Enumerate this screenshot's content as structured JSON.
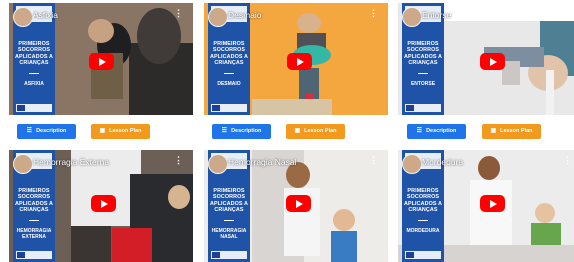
{
  "panel": {
    "title": "PRIMEIROS SOCORROS APLICADOS A CRIANÇAS"
  },
  "videos": [
    {
      "title": "Asfixia",
      "topic": "ASFIXIA",
      "bg": "#8a7a6a"
    },
    {
      "title": "Desmaio",
      "topic": "DESMAIO",
      "bg": "#f5a23f"
    },
    {
      "title": "Entorse",
      "topic": "ENTORSE",
      "bg": "#dedede"
    },
    {
      "title": "Hemorragia Externa",
      "topic": "HEMORRAGIA EXTERNA",
      "bg": "#6d5f55"
    },
    {
      "title": "Hemorragia Nasal",
      "topic": "HEMORRAGIA NASAL",
      "bg": "#e9e6e4"
    },
    {
      "title": "Mordedura",
      "topic": "MORDEDURA",
      "bg": "#e6e6e6"
    }
  ],
  "buttons": {
    "description": "Description",
    "lesson_plan": "Lesson Plan",
    "description_icon": "list-icon",
    "lesson_icon": "book-icon"
  },
  "colors": {
    "panel_blue": "#1f53a8",
    "description_button": "#1e74e8",
    "lesson_button": "#f2991e",
    "play_red": "#ff0000"
  }
}
